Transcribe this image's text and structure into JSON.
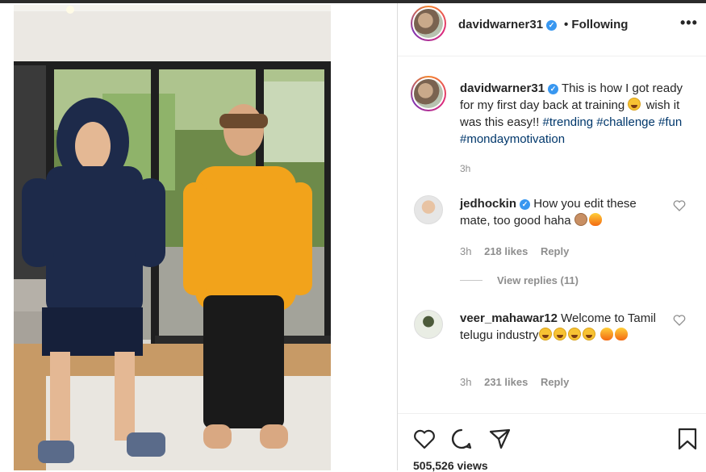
{
  "post": {
    "author": {
      "username": "davidwarner31",
      "verified_mark": "✓",
      "follow_status": "• Following",
      "more_icon": "•••"
    },
    "caption": {
      "username": "davidwarner31",
      "text_part1": "This is how I got ready for my first day back at training",
      "text_part2": "wish it was this easy!!",
      "hashtags": [
        "#trending",
        "#challenge",
        "#fun",
        "#mondaymotivation"
      ],
      "time": "3h"
    },
    "comments": [
      {
        "username": "jedhockin",
        "verified": true,
        "text": "How you edit these mate, too good haha",
        "time": "3h",
        "likes": "218 likes",
        "reply_label": "Reply",
        "view_replies": "View replies (11)"
      },
      {
        "username": "veer_mahawar12",
        "verified": false,
        "text": "Welcome to Tamil telugu industry",
        "time": "3h",
        "likes": "231 likes",
        "reply_label": "Reply"
      }
    ],
    "views": "505,526 views",
    "icons": [
      "like-heart-icon",
      "comment-bubble-icon",
      "share-plane-icon",
      "save-bookmark-icon"
    ],
    "colors": {
      "text": "#262626",
      "muted": "#8e8e8e",
      "hashtag": "#00376b",
      "verified": "#3897f0",
      "hoodie": "#1d2a4a",
      "sweater": "#f2a31b"
    }
  }
}
